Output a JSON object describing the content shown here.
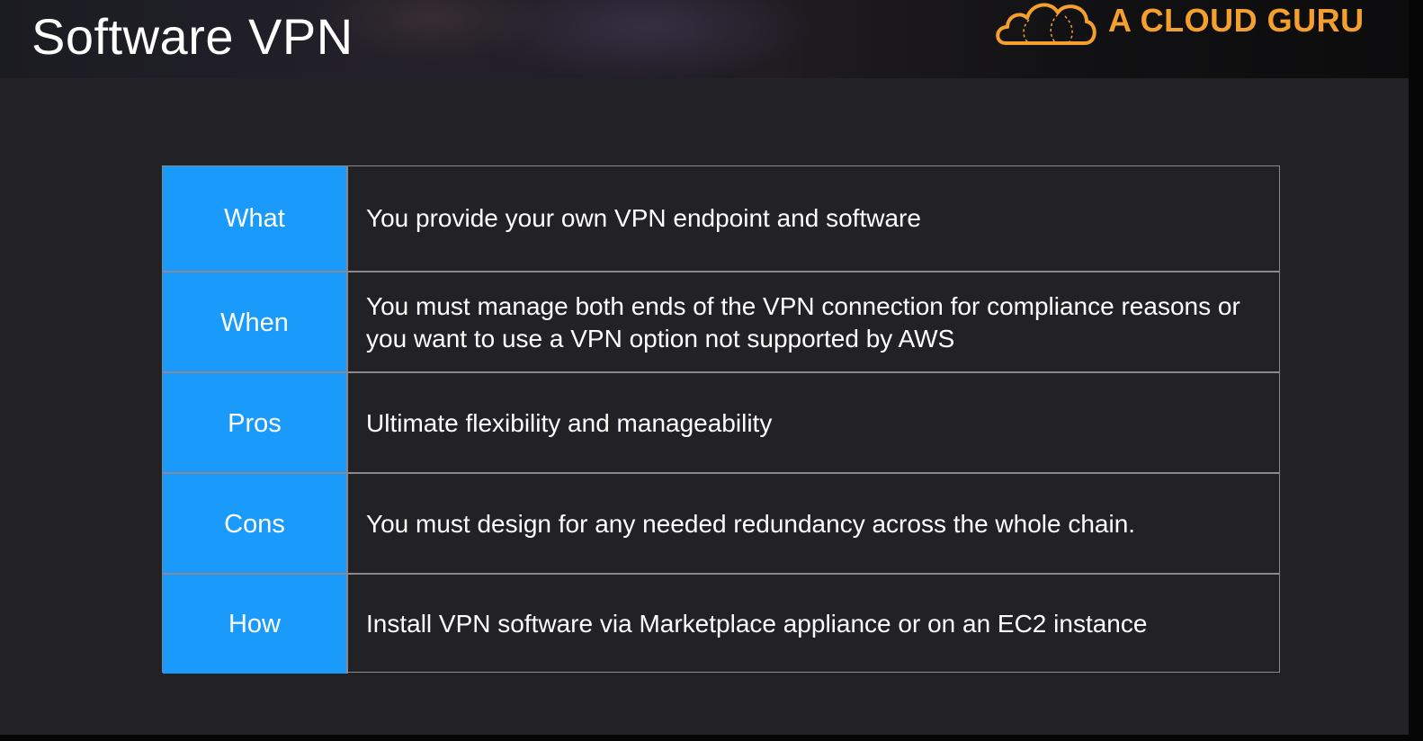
{
  "slide": {
    "title": "Software VPN",
    "brand": "A CLOUD GURU",
    "colors": {
      "label_bg": "#1a9bfb",
      "brand_orange": "#f5a02e",
      "background": "#222125"
    },
    "rows": [
      {
        "label": "What",
        "text": "You provide your own VPN endpoint and software"
      },
      {
        "label": "When",
        "text": "You must manage both ends of the VPN connection for compliance reasons or you want to use a VPN option not supported by AWS"
      },
      {
        "label": "Pros",
        "text": "Ultimate flexibility and manageability"
      },
      {
        "label": "Cons",
        "text": "You must design for any needed redundancy across the whole chain."
      },
      {
        "label": "How",
        "text": "Install VPN software via Marketplace appliance or on an EC2 instance"
      }
    ]
  }
}
